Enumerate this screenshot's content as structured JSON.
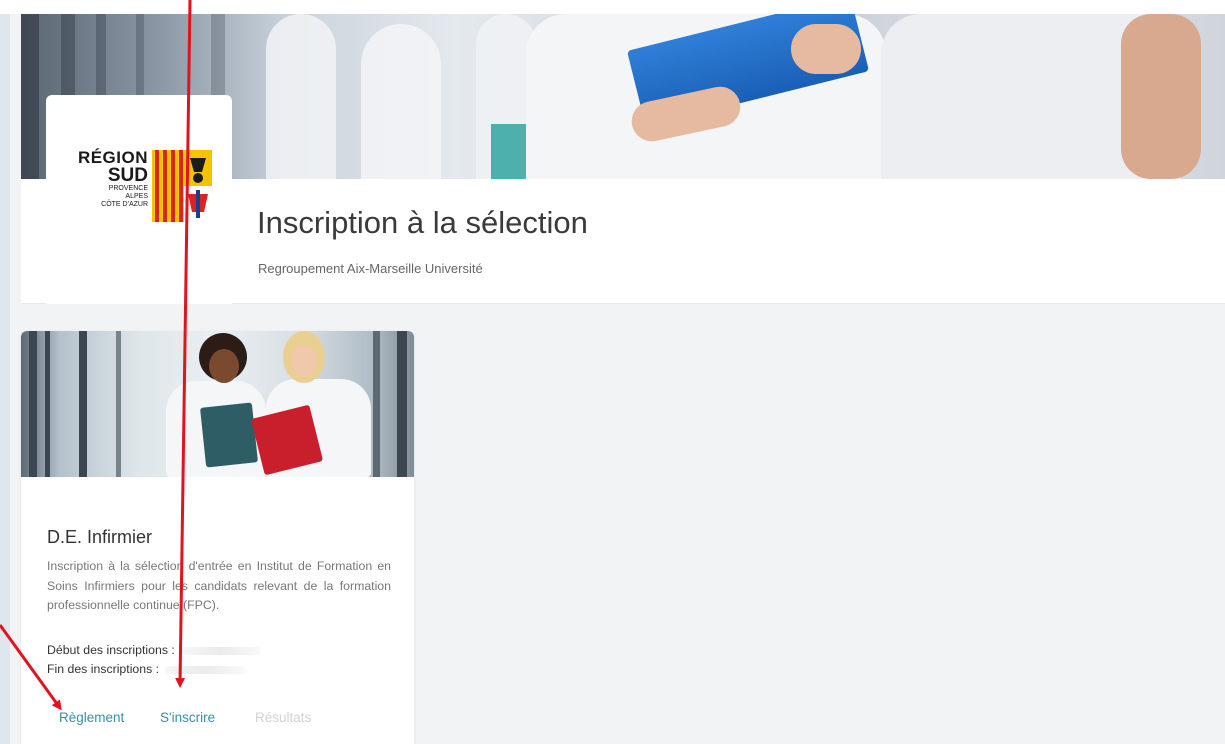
{
  "header": {
    "title": "Inscription à la sélection",
    "subtitle": "Regroupement Aix-Marseille Université"
  },
  "logo": {
    "line1": "RÉGION",
    "line2": "SUD",
    "line3": "PROVENCE",
    "line4": "ALPES",
    "line5": "CÔTE D'AZUR"
  },
  "course": {
    "title": "D.E. Infirmier",
    "description": "Inscription à la sélection d'entrée en Institut de Formation en Soins Infirmiers pour les candidats relevant de la formation professionnelle continue (FPC).",
    "start_label": "Début des inscriptions :",
    "end_label": "Fin des inscriptions :",
    "actions": {
      "rules": "Règlement",
      "register": "S'inscrire",
      "results": "Résultats"
    }
  },
  "colors": {
    "link": "#3a8ea8",
    "disabled_link": "#cfd3d6",
    "annotation_arrow": "#e0141e"
  }
}
